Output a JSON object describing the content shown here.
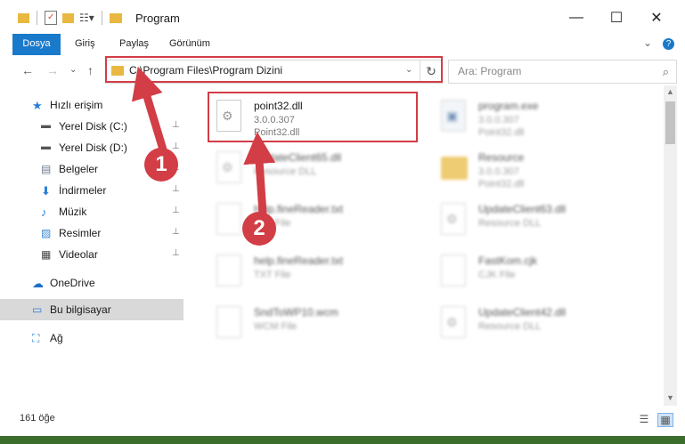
{
  "window": {
    "title": "Program"
  },
  "window_controls": {
    "minimize": "—",
    "maximize": "☐",
    "close": "✕"
  },
  "ribbon": {
    "tabs": [
      "Dosya",
      "Giriş",
      "Paylaş",
      "Görünüm"
    ],
    "collapse_glyph": "⌄",
    "help_glyph": "?"
  },
  "nav": {
    "back_glyph": "←",
    "forward_glyph": "→",
    "recent_glyph": "⌄",
    "up_glyph": "↑",
    "address": "C:\\Program Files\\Program Dizini",
    "dropdown_glyph": "⌄",
    "refresh_glyph": "↻",
    "search_placeholder": "Ara: Program",
    "search_glyph": "⌕"
  },
  "sidebar": {
    "items": [
      {
        "label": "Hızlı erişim",
        "icon": "star-icon",
        "pinned": false,
        "selected": false
      },
      {
        "label": "Yerel Disk (C:)",
        "icon": "drive-icon",
        "pinned": true,
        "selected": false
      },
      {
        "label": "Yerel Disk (D:)",
        "icon": "drive-icon",
        "pinned": true,
        "selected": false
      },
      {
        "label": "Belgeler",
        "icon": "documents-icon",
        "pinned": true,
        "selected": false
      },
      {
        "label": "İndirmeler",
        "icon": "download-icon",
        "pinned": true,
        "selected": false
      },
      {
        "label": "Müzik",
        "icon": "music-icon",
        "pinned": true,
        "selected": false
      },
      {
        "label": "Resimler",
        "icon": "pictures-icon",
        "pinned": true,
        "selected": false
      },
      {
        "label": "Videolar",
        "icon": "videos-icon",
        "pinned": true,
        "selected": false
      },
      {
        "label": "OneDrive",
        "icon": "cloud-icon",
        "pinned": false,
        "selected": false
      },
      {
        "label": "Bu bilgisayar",
        "icon": "computer-icon",
        "pinned": false,
        "selected": true
      },
      {
        "label": "Ağ",
        "icon": "network-icon",
        "pinned": false,
        "selected": false
      }
    ],
    "pin_glyph": "📌"
  },
  "files": [
    {
      "name": "point32.dll",
      "line1": "3.0.0.307",
      "line2": "Point32.dll",
      "type": "dll",
      "focus": true
    },
    {
      "name": "program.exe",
      "line1": "3.0.0.307",
      "line2": "Point32.dll",
      "type": "exe",
      "focus": false
    },
    {
      "name": "UpdateClient65.dll",
      "line1": "Resource DLL",
      "line2": "",
      "type": "dll",
      "focus": false
    },
    {
      "name": "Resource",
      "line1": "3.0.0.307",
      "line2": "Point32.dll",
      "type": "folder",
      "focus": false
    },
    {
      "name": "help.fineReader.txt",
      "line1": "TXT File",
      "line2": "",
      "type": "txt",
      "focus": false
    },
    {
      "name": "UpdateClient63.dll",
      "line1": "Resource DLL",
      "line2": "",
      "type": "dll",
      "focus": false
    },
    {
      "name": "help.fineReader.txt",
      "line1": "TXT File",
      "line2": "",
      "type": "txt",
      "focus": false
    },
    {
      "name": "FastKom.cjk",
      "line1": "CJK File",
      "line2": "",
      "type": "txt",
      "focus": false
    },
    {
      "name": "SndToWP10.wcm",
      "line1": "WCM File",
      "line2": "",
      "type": "txt",
      "focus": false
    },
    {
      "name": "UpdateClient42.dll",
      "line1": "Resource DLL",
      "line2": "",
      "type": "dll",
      "focus": false
    }
  ],
  "annotations": {
    "step1": "1",
    "step2": "2",
    "color": "#d23d46"
  },
  "status": {
    "count": "161 öğe",
    "details_glyph": "☰",
    "tiles_glyph": "▦"
  }
}
